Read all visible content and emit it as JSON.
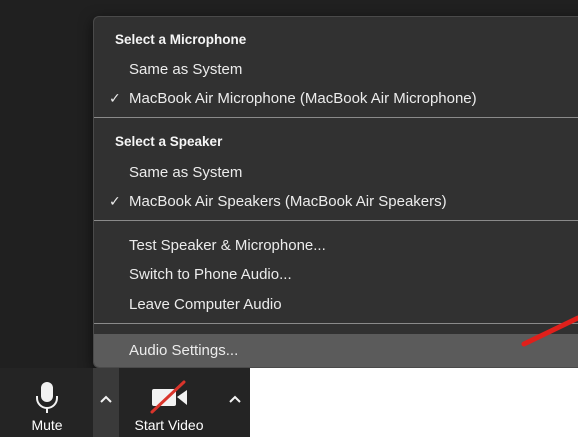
{
  "menu": {
    "microphone_header": "Select a Microphone",
    "mic_same_as_system": "Same as System",
    "mic_selected": "MacBook Air Microphone (MacBook Air Microphone)",
    "speaker_header": "Select a Speaker",
    "speaker_same_as_system": "Same as System",
    "speaker_selected": "MacBook Air Speakers (MacBook Air Speakers)",
    "test_speaker_mic": "Test Speaker & Microphone...",
    "switch_phone_audio": "Switch to Phone Audio...",
    "leave_computer_audio": "Leave Computer Audio",
    "audio_settings": "Audio Settings...",
    "checkmark": "✓"
  },
  "toolbar": {
    "mute_label": "Mute",
    "start_video_label": "Start Video"
  },
  "colors": {
    "menu_bg": "#313131",
    "hover_bg": "#5b5b5b",
    "arrow_red": "#e0201b",
    "video_slash_red": "#d9342b"
  },
  "icons": [
    "microphone-icon",
    "caret-up-icon",
    "video-camera-off-icon",
    "red-arrow-annotation"
  ]
}
